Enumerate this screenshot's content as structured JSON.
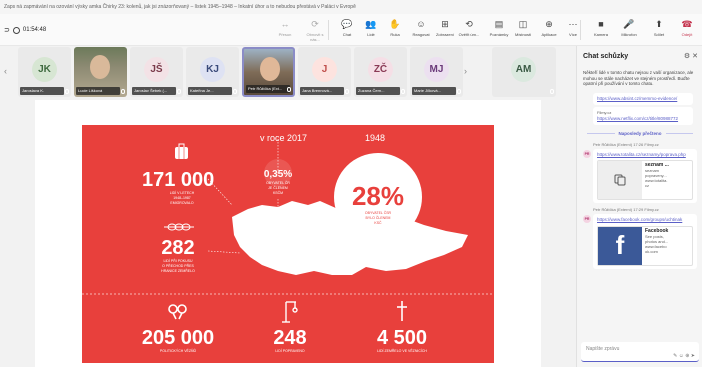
{
  "window_title": "Zaps ná zapmávání na ozování výsky amka Čhirky 23: kolenů, jak jsi znázorňovaný – lístek 1945–1948 – Inkatní úhor a to nebudou přestává v Paláci v Evropě",
  "meeting": {
    "timer": "01:54:48"
  },
  "toolbar": [
    {
      "label": "Přesun",
      "icon": "↔",
      "dim": true
    },
    {
      "label": "Obnovit s nás...",
      "icon": "⟳",
      "dim": true
    },
    {
      "label": "Chat",
      "icon": "💬"
    },
    {
      "label": "Lidé",
      "icon": "👥",
      "badge": "10"
    },
    {
      "label": "Ruka",
      "icon": "✋"
    },
    {
      "label": "Reagovat",
      "icon": "☺"
    },
    {
      "label": "Zobrazení",
      "icon": "⊞"
    },
    {
      "label": "Ověřit úm...",
      "icon": "⟲"
    },
    {
      "label": "Poznámky",
      "icon": "▤"
    },
    {
      "label": "Místnosti",
      "icon": "◫"
    },
    {
      "label": "Aplikace",
      "icon": "⊕"
    },
    {
      "label": "Více",
      "icon": "⋯"
    },
    {
      "label": "Kamera",
      "icon": "■"
    },
    {
      "label": "Mikrofon",
      "icon": "🎤"
    },
    {
      "label": "Sdílet",
      "icon": "⬆"
    },
    {
      "label": "Odejít",
      "icon": "☎"
    }
  ],
  "participants": [
    {
      "initials": "JK",
      "name": "Jaroslava K.",
      "bg": "#d7e6d3",
      "fg": "#3f6b3f"
    },
    {
      "initials": "",
      "name": "Lucie Lišková",
      "video": "video1"
    },
    {
      "initials": "JŠ",
      "name": "Jaroslav Šebek (...",
      "bg": "#f3e2e6",
      "fg": "#7a3a4a"
    },
    {
      "initials": "KJ",
      "name": "Kateřina Je...",
      "bg": "#dee2f3",
      "fg": "#3a4a7a"
    },
    {
      "initials": "",
      "name": "Petr Růžička (Ext...",
      "video": "video2"
    },
    {
      "initials": "J",
      "name": "Jana Brennová...",
      "bg": "#fde3df",
      "fg": "#c0504d"
    },
    {
      "initials": "ZČ",
      "name": "Zuzana Čern...",
      "bg": "#f5dfe6",
      "fg": "#8a3a55"
    },
    {
      "initials": "MJ",
      "name": "Marie Jílková...",
      "bg": "#ece0f0",
      "fg": "#6b3a7a"
    },
    {
      "initials": "AM",
      "name": "",
      "bg": "#dbe9df",
      "fg": "#3a5a44"
    }
  ],
  "slide": {
    "title_left": "v roce 2017",
    "title_right": "1948",
    "stat1": {
      "value": "171 000",
      "caption": [
        "LIDÍ V LETECH",
        "1948–1987",
        "EMIGROVALO"
      ]
    },
    "stat2": {
      "value": "282",
      "caption": [
        "LIDÍ PŘI POKUSU",
        "O PŘECHOD PŘES",
        "HRANICE ZEMŘELO"
      ]
    },
    "pct_small": {
      "value": "0,35%",
      "caption": [
        "OBYVATEL ČR",
        "JE ČLENEM",
        "KSČM"
      ]
    },
    "pct_big": {
      "value": "28%",
      "caption": [
        "OBYVATEL ČSR",
        "BYLO ČLENEM",
        "KSČ"
      ]
    },
    "bottom": [
      {
        "value": "205 000",
        "caption": "POLITICKÝCH VĚZŇŮ"
      },
      {
        "value": "248",
        "caption": "LIDÍ POPRAVENO"
      },
      {
        "value": "4 500",
        "caption": "LIDÍ ZEMŘELO VE VĚZNICÍCH"
      }
    ],
    "colors": {
      "bg": "#e8403c",
      "fg": "#ffffff"
    }
  },
  "chat": {
    "title": "Chat schůzky",
    "notice": "Někteří lidé v tomto chatu nejsou z vaší organizace, ale mohou se stále nacházet ve stejném prostředí. Buďte opatrní při používání v tomto chatu.",
    "prev": [
      {
        "link": "https://www.absint.cz/memmo-evidence/",
        "label": ""
      },
      {
        "link": "https://www.netflix.com/cz/title/80988772",
        "label": "Filmy.cz"
      }
    ],
    "divider": "Naposledy přečteno",
    "messages": [
      {
        "author": "Petr Růžička (Externí)",
        "time": "17:26",
        "tag": "Filmy.cz",
        "link": "https://www.totalita.cz/seznamy/poprava.php",
        "card_title": "seznam ...",
        "card_text": [
          "seznam",
          "popraveny...",
          "www.totalita.",
          "cz"
        ],
        "card_type": "doc"
      },
      {
        "author": "Petr Růžička (Externí)",
        "time": "17:29",
        "tag": "Filmy.cz",
        "link": "https://www.facebook.com/groups/uchtinak",
        "card_title": "Facebook",
        "card_text": [
          "See posts,",
          "photos and...",
          "www.facebo",
          "ok.com"
        ],
        "card_type": "fb"
      }
    ],
    "compose_placeholder": "Napište zprávu"
  }
}
